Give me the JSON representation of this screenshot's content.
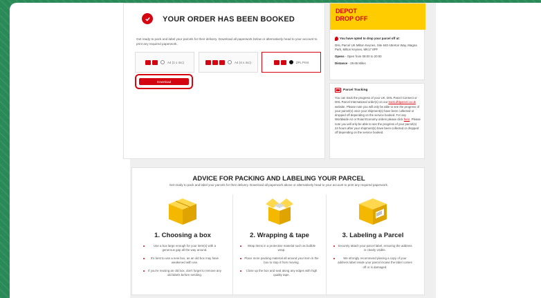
{
  "order": {
    "title": "YOUR ORDER HAS BEEN BOOKED",
    "description": "Get ready to pack and label your parcels for their delivery. Download all paperwork below or alternatively head to your account to print any required paperwork.",
    "print_options": [
      {
        "label": "A4 (1 x 4cc)",
        "selected": false
      },
      {
        "label": "A4 (4 x 4cc)",
        "selected": false
      },
      {
        "label": "ZPL Print",
        "selected": true
      }
    ],
    "download_label": "Download"
  },
  "depot": {
    "title_line1": "DEPOT",
    "title_line2": "DROP OFF",
    "opted": "You have opted to drop your parcel off at:",
    "address": "DHL Parcel UK Milton Keynes, Site 640 Atterton Way, Magna Park, Milton Keynes, MK17 8PF",
    "opens_label": "Opens",
    "opens_value": " - Open from 08:00 to 20:00",
    "distance_label": "Distance",
    "distance_value": " - 29.65 Miles"
  },
  "tracking": {
    "title": "Parcel Tracking",
    "text_a": "You can track the progress of your UK, DHL Parcel Connect or DHL Parcel International order(s) on our ",
    "link_a": "track.dhlparcel.co.uk",
    "text_b": " website. Please note you will only be able to see the progress of your parcel(s) once your shipment(s) have been collected or dropped off depending on the service booked. For any Worldwide Air or Road Economy orders please click ",
    "link_b": "here",
    "text_c": ". Please note you will only be able to see the progress of your parcel(s) 24 hours after your shipment(s) have been collected or dropped off depending on the service booked."
  },
  "advice": {
    "title": "ADVICE FOR PACKING AND LABELING YOUR PARCEL",
    "subtitle": "Get ready to pack and label your parcels for their delivery. Download all paperwork above or alternatively head to your account to print any required paperwork.",
    "steps": [
      {
        "title": "1. Choosing a box",
        "items": [
          "Use a box large enough for your item(s) with a generous gap all the way around.",
          "It's best to use a new box, as an old box may have weakened with use.",
          "If you're reusing an old box, don't forget to remove any old labels before sending."
        ]
      },
      {
        "title": "2. Wrapping & tape",
        "items": [
          "Wrap items in a protective material such as bubble wrap.",
          "Place more packing material all around your item in the box to stop it from moving.",
          "Close up the box and seal along any edges with high quality tape."
        ]
      },
      {
        "title": "3. Labeling a Parcel",
        "items": [
          "Securely attach your parcel label, ensuring the address is clearly visible.",
          "We strongly recommend placing a copy of your address label inside your parcel incase the label comes off or is damaged."
        ]
      }
    ]
  },
  "colors": {
    "brand_red": "#d40511",
    "brand_yellow": "#ffcc00"
  }
}
